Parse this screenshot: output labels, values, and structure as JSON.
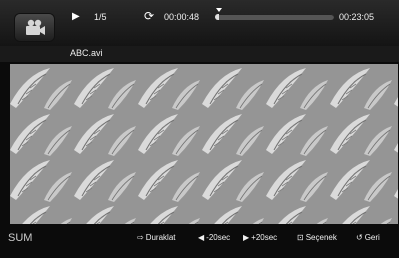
{
  "player": {
    "play_icon": "play-icon",
    "track_position": "1/5",
    "repeat_icon": "repeat-icon",
    "current_time": "00:00:48",
    "total_time": "00:23:05",
    "progress_fraction": 0.035
  },
  "file": {
    "name": "ABC.avi"
  },
  "bottom": {
    "sum_label": "SUM",
    "pause_label": "Duraklat",
    "rewind_label": "-20sec",
    "forward_label": "+20sec",
    "options_label": "Seçenek",
    "back_label": "Geri"
  },
  "colors": {
    "background": "#0b0b0b",
    "video": "#9a9a9a"
  }
}
